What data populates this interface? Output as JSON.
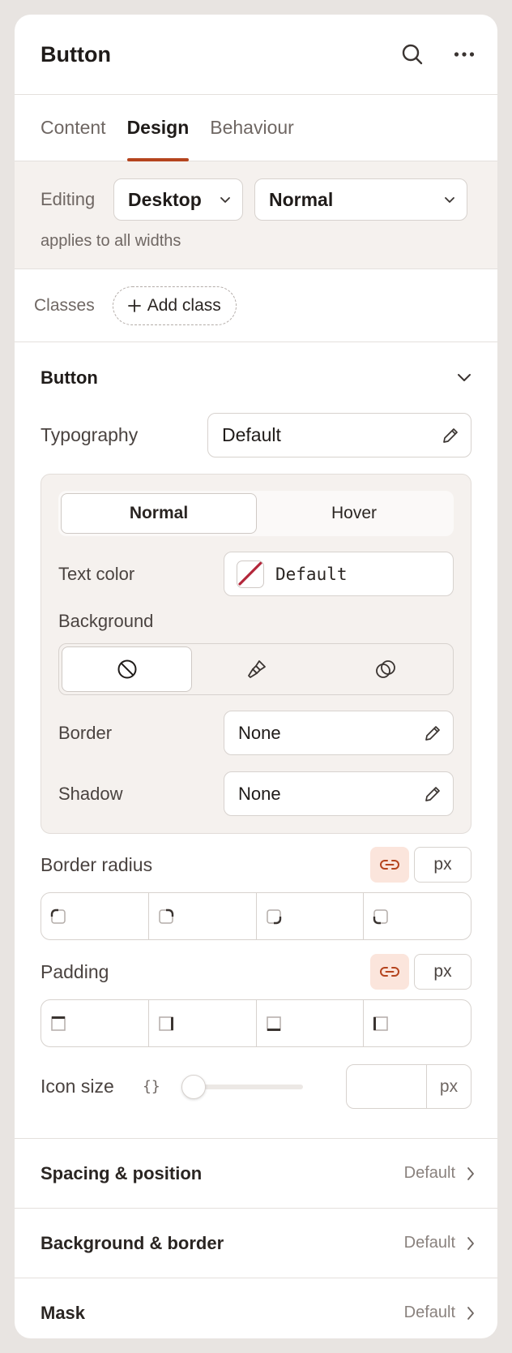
{
  "header": {
    "title": "Button"
  },
  "tabs": [
    {
      "label": "Content",
      "active": false
    },
    {
      "label": "Design",
      "active": true
    },
    {
      "label": "Behaviour",
      "active": false
    }
  ],
  "editing": {
    "label": "Editing",
    "device": "Desktop",
    "state": "Normal",
    "note": "applies to all widths"
  },
  "classes": {
    "label": "Classes",
    "add_label": "Add class"
  },
  "button_section": {
    "title": "Button",
    "typography": {
      "label": "Typography",
      "value": "Default"
    },
    "state_tabs": [
      {
        "label": "Normal",
        "active": true
      },
      {
        "label": "Hover",
        "active": false
      }
    ],
    "text_color": {
      "label": "Text color",
      "value": "Default"
    },
    "background": {
      "label": "Background",
      "options": [
        "none-icon",
        "brush-icon",
        "gradient-icon"
      ],
      "selected": "none-icon"
    },
    "border": {
      "label": "Border",
      "value": "None"
    },
    "shadow": {
      "label": "Shadow",
      "value": "None"
    },
    "border_radius": {
      "label": "Border radius",
      "unit": "px"
    },
    "padding": {
      "label": "Padding",
      "unit": "px"
    },
    "icon_size": {
      "label": "Icon size",
      "var_glyph": "{}",
      "unit": "px",
      "slider_fraction": 0
    }
  },
  "collapsibles": [
    {
      "title": "Spacing & position",
      "value": "Default"
    },
    {
      "title": "Background & border",
      "value": "Default"
    },
    {
      "title": "Mask",
      "value": "Default"
    }
  ],
  "colors": {
    "accent": "#b5441e",
    "link_bg": "#fbe5dc",
    "swatch_slash": "#b3263a"
  }
}
